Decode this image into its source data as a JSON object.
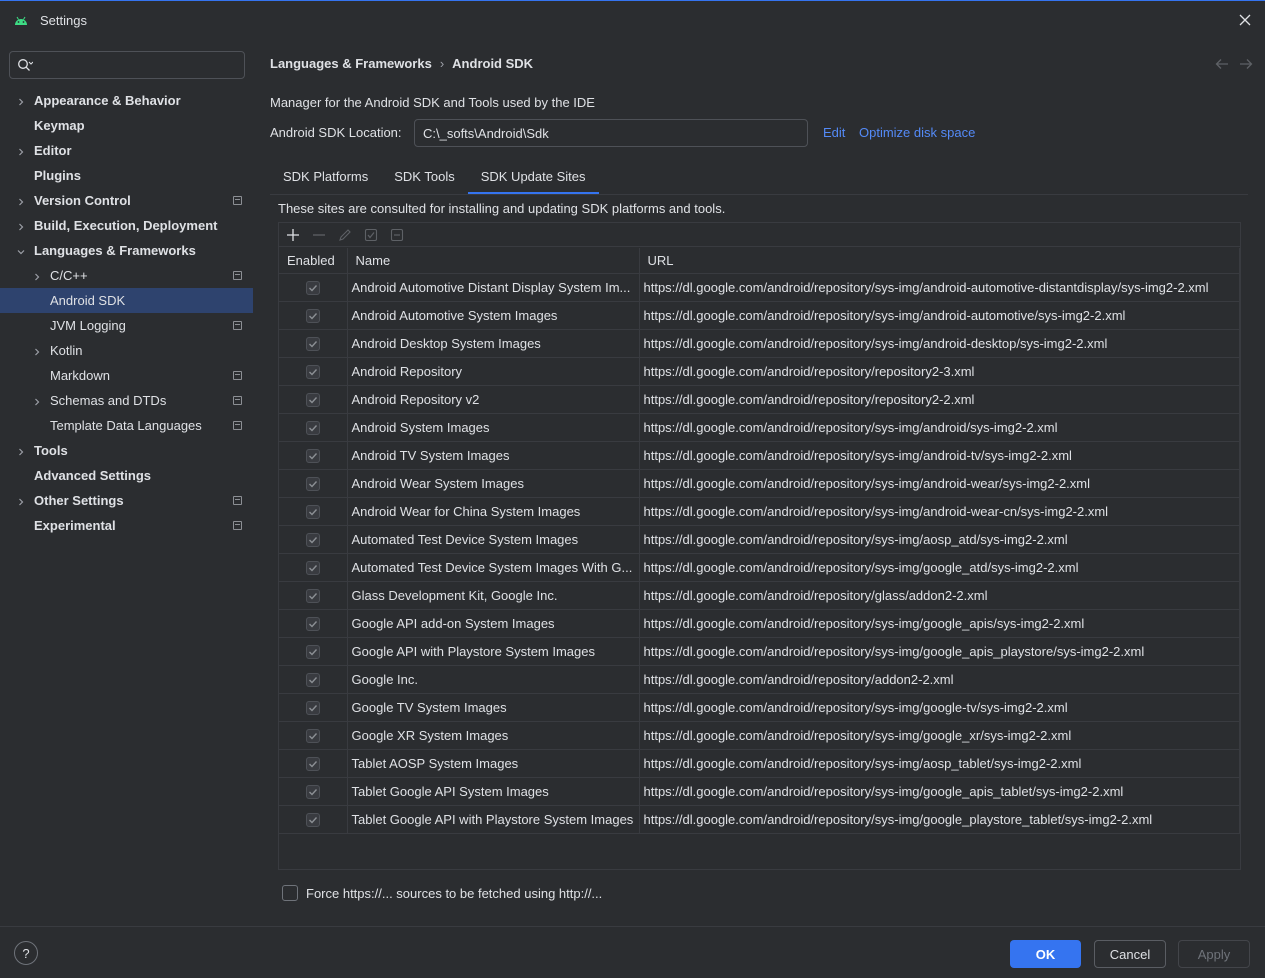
{
  "window": {
    "title": "Settings"
  },
  "sidebar": {
    "search_placeholder": "",
    "items": [
      {
        "label": "Appearance & Behavior",
        "chevron": "right"
      },
      {
        "label": "Keymap",
        "chevron": ""
      },
      {
        "label": "Editor",
        "chevron": "right"
      },
      {
        "label": "Plugins",
        "chevron": ""
      },
      {
        "label": "Version Control",
        "chevron": "right"
      },
      {
        "label": "Build, Execution, Deployment",
        "chevron": "right"
      },
      {
        "label": "Languages & Frameworks",
        "chevron": "down"
      },
      {
        "label": "C/C++",
        "chevron": "right"
      },
      {
        "label": "Android SDK",
        "chevron": ""
      },
      {
        "label": "JVM Logging",
        "chevron": ""
      },
      {
        "label": "Kotlin",
        "chevron": "right"
      },
      {
        "label": "Markdown",
        "chevron": ""
      },
      {
        "label": "Schemas and DTDs",
        "chevron": "right"
      },
      {
        "label": "Template Data Languages",
        "chevron": ""
      },
      {
        "label": "Tools",
        "chevron": "right"
      },
      {
        "label": "Advanced Settings",
        "chevron": ""
      },
      {
        "label": "Other Settings",
        "chevron": "right"
      },
      {
        "label": "Experimental",
        "chevron": ""
      }
    ]
  },
  "breadcrumb": {
    "parent": "Languages & Frameworks",
    "separator": "›",
    "current": "Android SDK"
  },
  "main": {
    "description": "Manager for the Android SDK and Tools used by the IDE",
    "location_label": "Android SDK Location:",
    "location_value": "C:\\_softs\\Android\\Sdk",
    "edit_link": "Edit",
    "optimize_link": "Optimize disk space",
    "tabs": [
      {
        "label": "SDK Platforms",
        "active": false
      },
      {
        "label": "SDK Tools",
        "active": false
      },
      {
        "label": "SDK Update Sites",
        "active": true
      }
    ],
    "sites_description": "These sites are consulted for installing and updating SDK platforms and tools.",
    "columns": {
      "enabled": "Enabled",
      "name": "Name",
      "url": "URL"
    },
    "rows": [
      {
        "name": "Android Automotive Distant Display System Im...",
        "url": "https://dl.google.com/android/repository/sys-img/android-automotive-distantdisplay/sys-img2-2.xml"
      },
      {
        "name": "Android Automotive System Images",
        "url": "https://dl.google.com/android/repository/sys-img/android-automotive/sys-img2-2.xml"
      },
      {
        "name": "Android Desktop System Images",
        "url": "https://dl.google.com/android/repository/sys-img/android-desktop/sys-img2-2.xml"
      },
      {
        "name": "Android Repository",
        "url": "https://dl.google.com/android/repository/repository2-3.xml"
      },
      {
        "name": "Android Repository v2",
        "url": "https://dl.google.com/android/repository/repository2-2.xml"
      },
      {
        "name": "Android System Images",
        "url": "https://dl.google.com/android/repository/sys-img/android/sys-img2-2.xml"
      },
      {
        "name": "Android TV System Images",
        "url": "https://dl.google.com/android/repository/sys-img/android-tv/sys-img2-2.xml"
      },
      {
        "name": "Android Wear System Images",
        "url": "https://dl.google.com/android/repository/sys-img/android-wear/sys-img2-2.xml"
      },
      {
        "name": "Android Wear for China System Images",
        "url": "https://dl.google.com/android/repository/sys-img/android-wear-cn/sys-img2-2.xml"
      },
      {
        "name": "Automated Test Device System Images",
        "url": "https://dl.google.com/android/repository/sys-img/aosp_atd/sys-img2-2.xml"
      },
      {
        "name": "Automated Test Device System Images With G...",
        "url": "https://dl.google.com/android/repository/sys-img/google_atd/sys-img2-2.xml"
      },
      {
        "name": "Glass Development Kit, Google Inc.",
        "url": "https://dl.google.com/android/repository/glass/addon2-2.xml"
      },
      {
        "name": "Google API add-on System Images",
        "url": "https://dl.google.com/android/repository/sys-img/google_apis/sys-img2-2.xml"
      },
      {
        "name": "Google API with Playstore System Images",
        "url": "https://dl.google.com/android/repository/sys-img/google_apis_playstore/sys-img2-2.xml"
      },
      {
        "name": "Google Inc.",
        "url": "https://dl.google.com/android/repository/addon2-2.xml"
      },
      {
        "name": "Google TV System Images",
        "url": "https://dl.google.com/android/repository/sys-img/google-tv/sys-img2-2.xml"
      },
      {
        "name": "Google XR System Images",
        "url": "https://dl.google.com/android/repository/sys-img/google_xr/sys-img2-2.xml"
      },
      {
        "name": "Tablet AOSP System Images",
        "url": "https://dl.google.com/android/repository/sys-img/aosp_tablet/sys-img2-2.xml"
      },
      {
        "name": "Tablet Google API System Images",
        "url": "https://dl.google.com/android/repository/sys-img/google_apis_tablet/sys-img2-2.xml"
      },
      {
        "name": "Tablet Google API with Playstore System Images",
        "url": "https://dl.google.com/android/repository/sys-img/google_playstore_tablet/sys-img2-2.xml"
      }
    ],
    "force_http_label": "Force https://... sources to be fetched using http://..."
  },
  "footer": {
    "help": "?",
    "ok": "OK",
    "cancel": "Cancel",
    "apply": "Apply"
  },
  "colors": {
    "accent": "#3574f0",
    "link": "#548af7",
    "selection": "#2e436e",
    "background": "#2b2d30"
  }
}
